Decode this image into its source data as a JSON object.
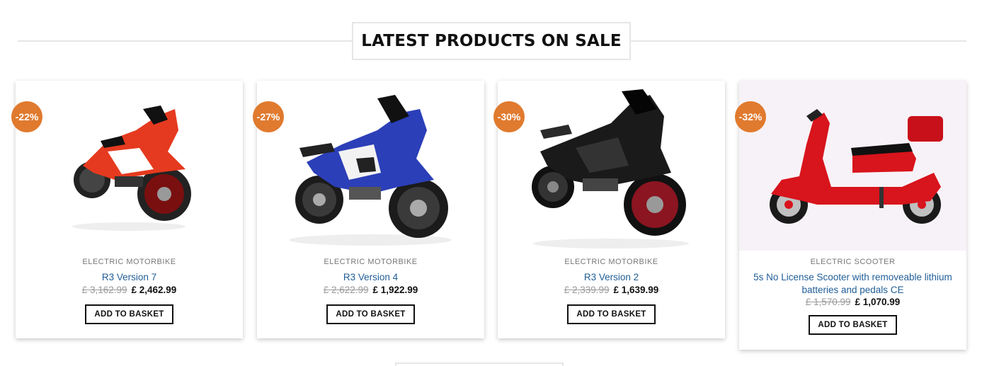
{
  "section": {
    "title": "LATEST PRODUCTS ON SALE"
  },
  "products": [
    {
      "badge": "-22%",
      "category": "ELECTRIC MOTORBIKE",
      "name": "R3 Version 7",
      "old_price": "£ 3,162.99",
      "price": "£ 2,462.99",
      "button": "ADD TO BASKET",
      "color": "#e53a1f"
    },
    {
      "badge": "-27%",
      "category": "ELECTRIC MOTORBIKE",
      "name": "R3 Version 4",
      "old_price": "£ 2,622.99",
      "price": "£ 1,922.99",
      "button": "ADD TO BASKET",
      "color": "#2b3fb8"
    },
    {
      "badge": "-30%",
      "category": "ELECTRIC MOTORBIKE",
      "name": "R3 Version 2",
      "old_price": "£ 2,339.99",
      "price": "£ 1,639.99",
      "button": "ADD TO BASKET",
      "color": "#1a1a1a"
    },
    {
      "badge": "-32%",
      "category": "ELECTRIC SCOOTER",
      "name": "5s No License Scooter with removeable lithium batteries and pedals CE",
      "old_price": "£ 1,570.99",
      "price": "£ 1,070.99",
      "button": "ADD TO BASKET",
      "color": "#d8141c"
    }
  ],
  "colors": {
    "badge": "#e07a2e",
    "link": "#1f5d97"
  }
}
